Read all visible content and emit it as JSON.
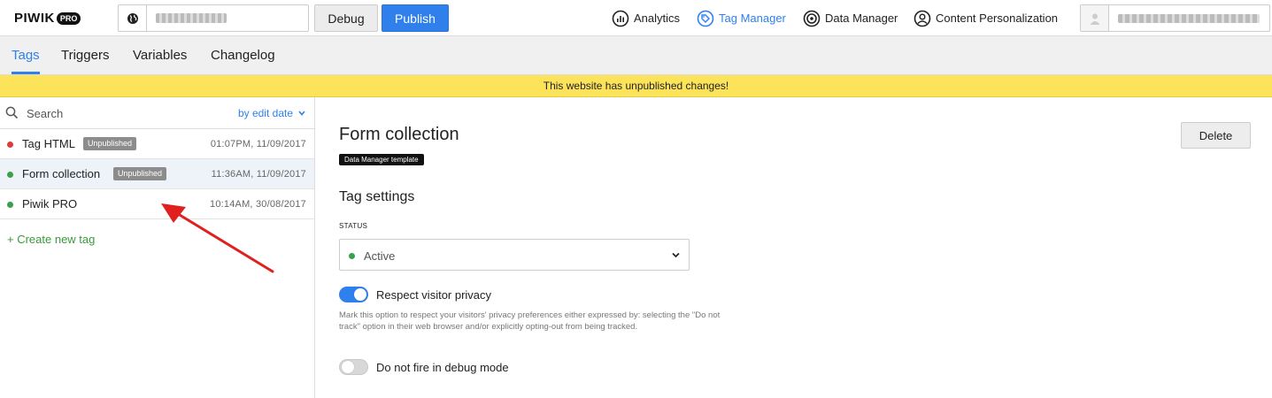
{
  "header": {
    "logo_text": "PIWIK",
    "logo_badge": "PRO",
    "debug_label": "Debug",
    "publish_label": "Publish",
    "nav": [
      {
        "label": "Analytics",
        "icon": "analytics-icon",
        "active": false
      },
      {
        "label": "Tag Manager",
        "icon": "tag-icon",
        "active": true
      },
      {
        "label": "Data Manager",
        "icon": "target-icon",
        "active": false
      },
      {
        "label": "Content Personalization",
        "icon": "person-icon",
        "active": false
      }
    ]
  },
  "tabs": [
    {
      "label": "Tags",
      "active": true
    },
    {
      "label": "Triggers",
      "active": false
    },
    {
      "label": "Variables",
      "active": false
    },
    {
      "label": "Changelog",
      "active": false
    }
  ],
  "banner": {
    "text": "This website has unpublished changes!"
  },
  "sidebar": {
    "search_placeholder": "Search",
    "sort_label": "by edit date",
    "tags": [
      {
        "name": "Tag HTML",
        "badge": "Unpublished",
        "date": "01:07PM, 11/09/2017",
        "status_color": "#e03b3b"
      },
      {
        "name": "Form collection",
        "badge": "Unpublished",
        "date": "11:36AM, 11/09/2017",
        "status_color": "#3aa14a"
      },
      {
        "name": "Piwik PRO",
        "badge": "",
        "date": "10:14AM, 30/08/2017",
        "status_color": "#3aa14a"
      }
    ],
    "create_label": "+ Create new tag"
  },
  "main": {
    "title": "Form collection",
    "template_badge": "Data Manager template",
    "delete_label": "Delete",
    "section_title": "Tag settings",
    "status_label": "STATUS",
    "status_value": "Active",
    "privacy_label": "Respect visitor privacy",
    "privacy_enabled": true,
    "privacy_help": "Mark this option to respect your visitors' privacy preferences either expressed by: selecting the \"Do not track\" option in their web browser and/or explicitly opting-out from being tracked.",
    "debug_label": "Do not fire in debug mode",
    "debug_enabled": false
  },
  "colors": {
    "accent": "#2f80ed",
    "banner": "#fde35a",
    "active_green": "#3aa14a",
    "error_red": "#e03b3b",
    "annotation_arrow": "#e0201f"
  }
}
